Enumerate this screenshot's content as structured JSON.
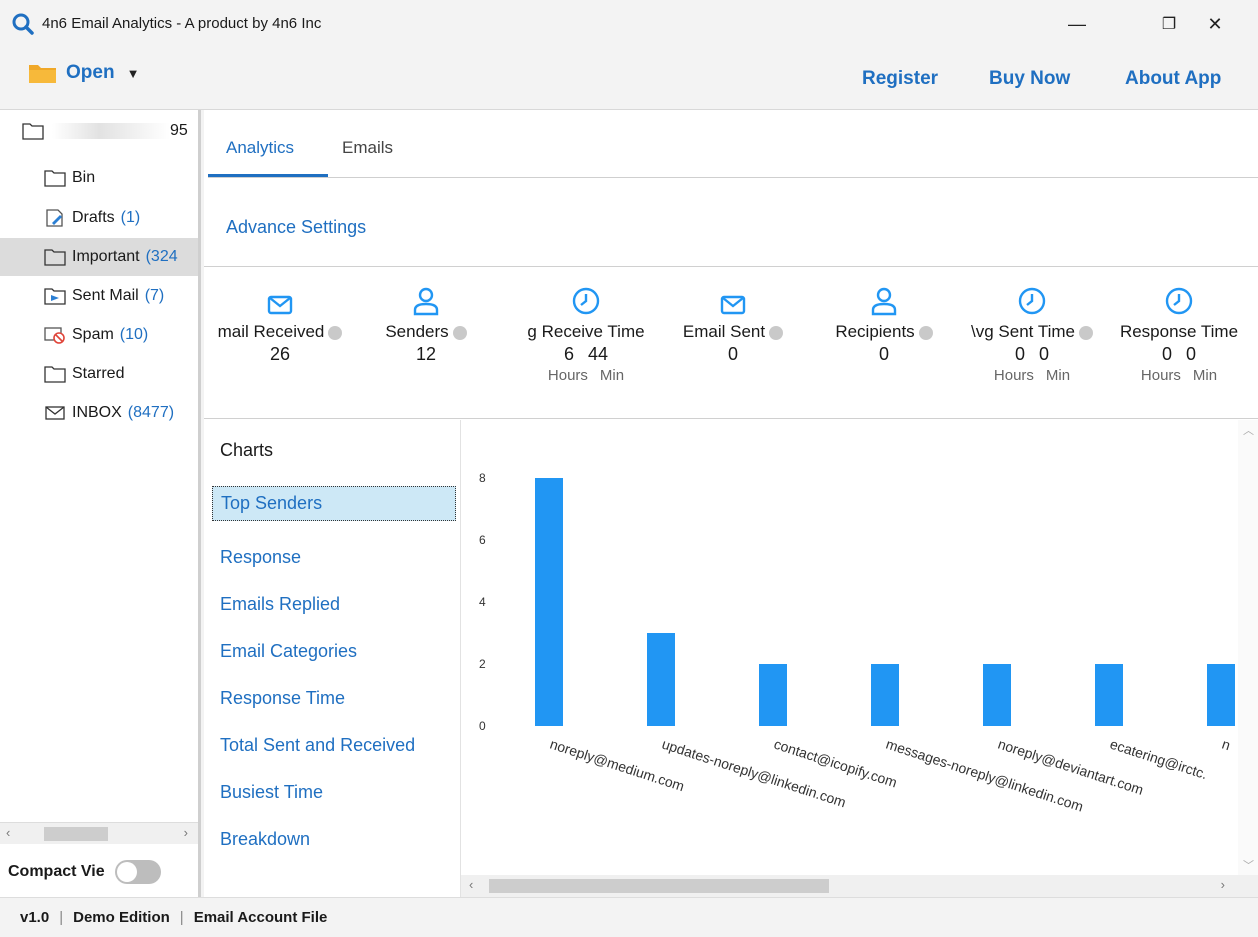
{
  "window": {
    "title": "4n6 Email Analytics - A product by 4n6 Inc",
    "minimize": "—",
    "restore": "❐",
    "close": "✕"
  },
  "toolbar": {
    "open_label": "Open",
    "register_label": "Register",
    "buy_now_label": "Buy Now",
    "about_label": "About App"
  },
  "sidebar": {
    "root_label": "95",
    "folders": [
      {
        "label": "Bin",
        "count": "",
        "icon": "folder-icon"
      },
      {
        "label": "Drafts",
        "count": "(1)",
        "icon": "drafts-icon"
      },
      {
        "label": "Important",
        "count": "(324",
        "icon": "folder-icon"
      },
      {
        "label": "Sent Mail",
        "count": "(7)",
        "icon": "sent-icon"
      },
      {
        "label": "Spam",
        "count": "(10)",
        "icon": "spam-icon"
      },
      {
        "label": "Starred",
        "count": "",
        "icon": "folder-icon"
      },
      {
        "label": "INBOX",
        "count": "(8477)",
        "icon": "envelope-icon"
      }
    ],
    "compact_label": "Compact Vie"
  },
  "tabs": {
    "analytics": "Analytics",
    "emails": "Emails"
  },
  "advance_settings": "Advance Settings",
  "stats": [
    {
      "label": "mail Received",
      "value": "26"
    },
    {
      "label": "Senders",
      "value": "12"
    },
    {
      "label": "g Receive Time",
      "hours": "6",
      "mins": "44",
      "hours_unit": "Hours",
      "mins_unit": "Min"
    },
    {
      "label": "Email Sent",
      "value": "0"
    },
    {
      "label": "Recipients",
      "value": "0"
    },
    {
      "label": "\\vg Sent Time",
      "hours": "0",
      "mins": "0",
      "hours_unit": "Hours",
      "mins_unit": "Min"
    },
    {
      "label": "Response Time",
      "hours": "0",
      "mins": "0",
      "hours_unit": "Hours",
      "mins_unit": "Min"
    }
  ],
  "charts_menu": {
    "heading": "Charts",
    "items": [
      "Top Senders",
      "Response",
      "Emails Replied",
      "Email Categories",
      "Response Time",
      "Total Sent and Received",
      "Busiest Time",
      "Breakdown"
    ]
  },
  "chart_data": {
    "type": "bar",
    "categories": [
      "noreply@medium.com",
      "updates-noreply@linkedin.com",
      "contact@icopify.com",
      "messages-noreply@linkedin.com",
      "noreply@deviantart.com",
      "ecatering@irctc.",
      "n"
    ],
    "values": [
      8,
      3,
      2,
      2,
      2,
      2,
      2
    ],
    "yticks": [
      "0",
      "2",
      "4",
      "6",
      "8"
    ],
    "ylim": [
      0,
      8
    ],
    "bar_color": "#2196f3"
  },
  "statusbar": {
    "version": "v1.0",
    "edition": "Demo Edition",
    "file": "Email Account File",
    "sep": "|"
  }
}
